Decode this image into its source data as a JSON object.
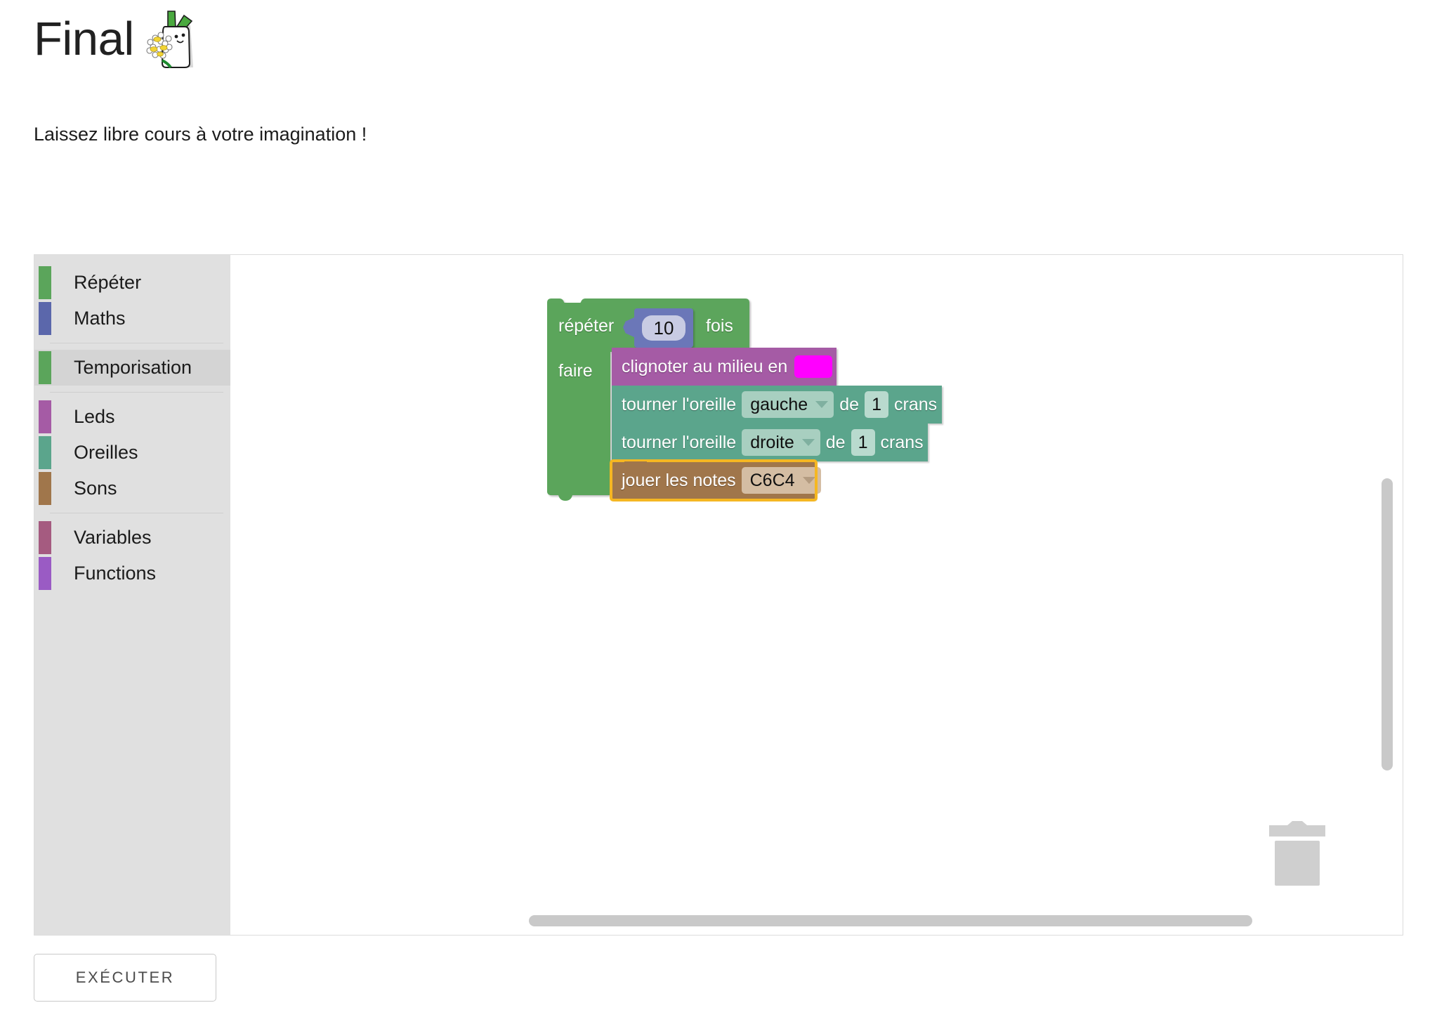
{
  "header": {
    "title": "Final",
    "logo_icon": "bunny-daisy-logo",
    "subtitle": "Laissez libre cours à votre imagination !"
  },
  "toolbox": {
    "groups": [
      {
        "items": [
          {
            "label": "Répéter",
            "color": "#5ba55b",
            "selected": false
          },
          {
            "label": "Maths",
            "color": "#5b67ab",
            "selected": false
          }
        ]
      },
      {
        "items": [
          {
            "label": "Temporisation",
            "color": "#5ba55b",
            "selected": true
          }
        ]
      },
      {
        "items": [
          {
            "label": "Leds",
            "color": "#a55ba5",
            "selected": false
          },
          {
            "label": "Oreilles",
            "color": "#5ba58c",
            "selected": false
          },
          {
            "label": "Sons",
            "color": "#a0764b",
            "selected": false
          }
        ]
      },
      {
        "items": [
          {
            "label": "Variables",
            "color": "#a55b80",
            "selected": false
          },
          {
            "label": "Functions",
            "color": "#9a5bc4",
            "selected": false
          }
        ]
      }
    ]
  },
  "workspace": {
    "blocks": {
      "repeat": {
        "label": "répéter",
        "times_value": "10",
        "suffix": "fois",
        "do_label": "faire",
        "color": "#5ba55b",
        "number_block_color": "#6b77b8"
      },
      "blink": {
        "label": "clignoter au milieu en",
        "swatch_color": "#ff00ff",
        "color": "#a55ba5"
      },
      "ear_left": {
        "label": "tourner l'oreille",
        "side": "gauche",
        "de": "de",
        "amount": "1",
        "unit": "crans",
        "color": "#5ba58c"
      },
      "ear_right": {
        "label": "tourner l'oreille",
        "side": "droite",
        "de": "de",
        "amount": "1",
        "unit": "crans",
        "color": "#5ba58c"
      },
      "notes": {
        "label": "jouer les notes",
        "notes_value": "C6C4",
        "color": "#a0764b",
        "selected_outline_color": "#f5b722"
      }
    },
    "trash_icon": "trash-can-icon",
    "scrollbar_color": "#c9c9c9"
  },
  "actions": {
    "run_label": "EXÉCUTER"
  }
}
